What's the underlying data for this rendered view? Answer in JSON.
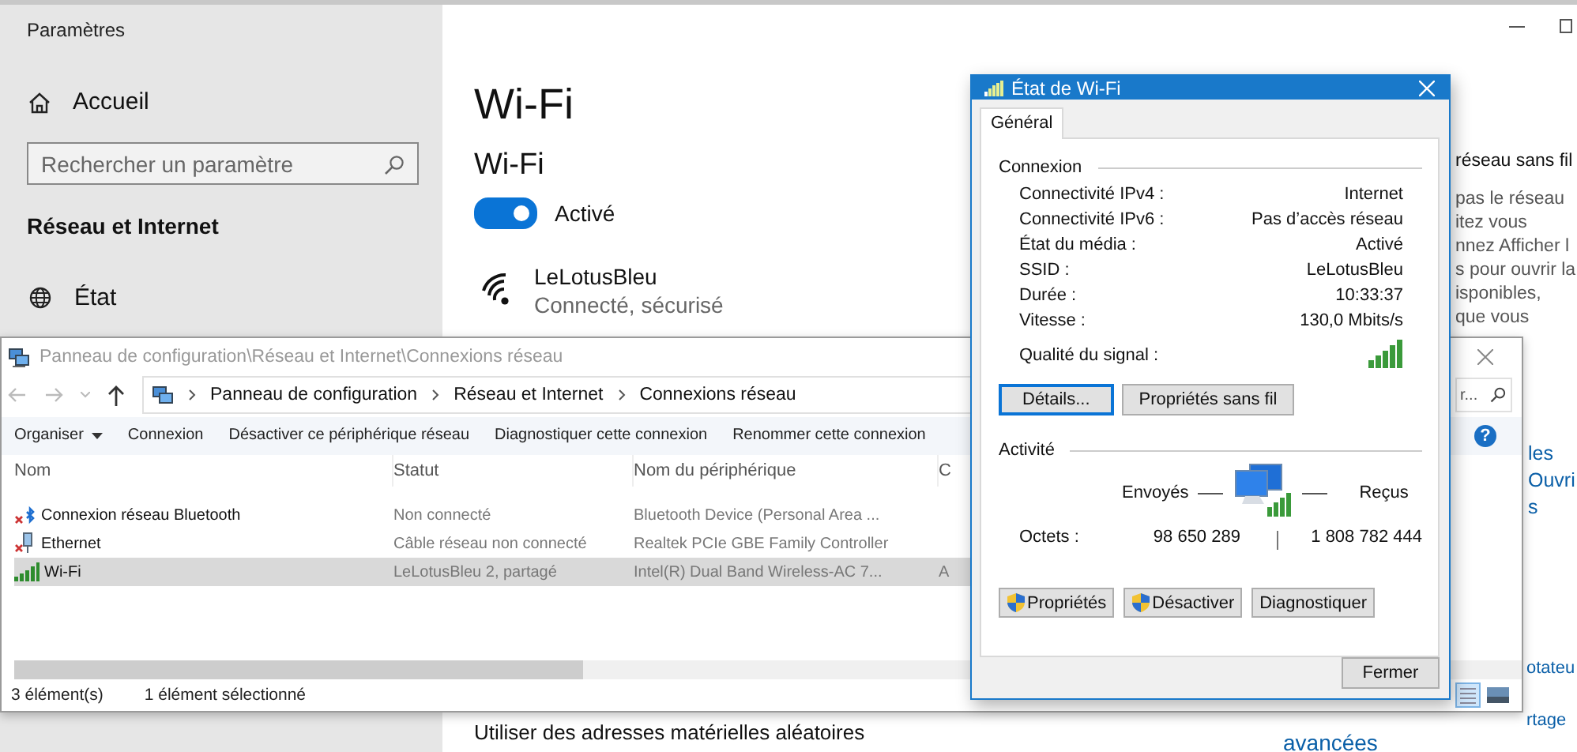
{
  "settings": {
    "title": "Paramètres",
    "home": "Accueil",
    "search": {
      "placeholder": "Rechercher un paramètre"
    },
    "section": "Réseau et Internet",
    "nav": [
      {
        "label": "État"
      }
    ],
    "page_title": "Wi-Fi",
    "wifi_label": "Wi-Fi",
    "toggle": {
      "on": true,
      "label": "Activé"
    },
    "network": {
      "name": "LeLotusBleu",
      "status": "Connecté, sécurisé"
    },
    "side_heading": "réseau sans fil",
    "side_lines": [
      "pas le réseau",
      "itez vous",
      "nnez Afficher l",
      "s pour ouvrir la",
      "isponibles,",
      "que vous"
    ],
    "side_links": [
      "les",
      "Ouvri",
      "s"
    ],
    "lower_links": [
      "otateu",
      "rtage"
    ],
    "footer_text": "Utiliser des adresses matérielles aléatoires",
    "footer_link": "avancées"
  },
  "control_panel": {
    "title": "Panneau de configuration\\Réseau et Internet\\Connexions réseau",
    "breadcrumb": [
      "Panneau de configuration",
      "Réseau et Internet",
      "Connexions réseau"
    ],
    "search": {
      "placeholder": "r..."
    },
    "toolbar": [
      {
        "label": "Organiser",
        "kind": "menu"
      },
      {
        "label": "Connexion",
        "kind": "button"
      },
      {
        "label": "Désactiver ce périphérique réseau",
        "kind": "button"
      },
      {
        "label": "Diagnostiquer cette connexion",
        "kind": "button"
      },
      {
        "label": "Renommer cette connexion",
        "kind": "button"
      }
    ],
    "help": "?",
    "columns": [
      "Nom",
      "Statut",
      "Nom du périphérique",
      "C"
    ],
    "rows": [
      {
        "kind": "bluetooth",
        "name": "Connexion réseau Bluetooth",
        "status": "Non connecté",
        "device": "Bluetooth Device (Personal Area ...",
        "column_4": "",
        "selected": false
      },
      {
        "kind": "ethernet",
        "name": "Ethernet",
        "status": "Câble réseau non connecté",
        "device": "Realtek PCIe GBE Family Controller",
        "column_4": "",
        "selected": false
      },
      {
        "kind": "wifi",
        "name": "Wi-Fi",
        "status": "LeLotusBleu  2, partagé",
        "device": "Intel(R) Dual Band Wireless-AC 7...",
        "column_4": "A",
        "selected": true
      }
    ],
    "status_bar": [
      "3 élément(s)",
      "1 élément sélectionné"
    ]
  },
  "dialog": {
    "title": "État de Wi-Fi",
    "tab": "Général",
    "connection_label": "Connexion",
    "fields": [
      {
        "label": "Connectivité IPv4 :",
        "value": "Internet"
      },
      {
        "label": "Connectivité IPv6 :",
        "value": "Pas d’accès réseau"
      },
      {
        "label": "État du média :",
        "value": "Activé"
      },
      {
        "label": "SSID :",
        "value": "LeLotusBleu"
      },
      {
        "label": "Durée :",
        "value": "10:33:37"
      },
      {
        "label": "Vitesse :",
        "value": "130,0 Mbits/s"
      }
    ],
    "signal_label": "Qualité du signal :",
    "buttons": [
      {
        "label": "Détails...",
        "focused": true
      },
      {
        "label": "Propriétés sans fil",
        "focused": false
      }
    ],
    "activity_label": "Activité",
    "sent_label": "Envoyés",
    "received_label": "Reçus",
    "bytes_label": "Octets :",
    "bytes_sent": "98 650 289",
    "bytes_received": "1 808 782 444",
    "actions": [
      {
        "label": "Propriétés",
        "shield": true
      },
      {
        "label": "Désactiver",
        "shield": true
      },
      {
        "label": "Diagnostiquer",
        "shield": false
      }
    ],
    "close_button": "Fermer"
  }
}
